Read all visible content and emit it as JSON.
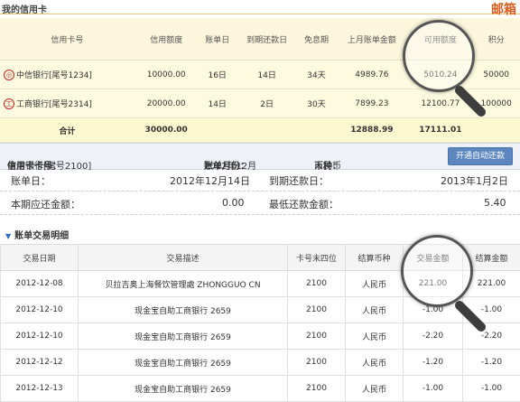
{
  "header": {
    "title": "我的信用卡",
    "mailbox": "邮箱"
  },
  "summary": {
    "columns": [
      "信用卡号",
      "信用额度",
      "账单日",
      "到期还款日",
      "免息期",
      "上月账单金额",
      "可用额度",
      "积分"
    ],
    "rows": [
      {
        "card": "中信银行[尾号1234]",
        "limit": "10000.00",
        "statement_day": "16日",
        "due_day": "14日",
        "free_period": "34天",
        "last_bill": "4989.76",
        "available": "5010.24",
        "points": "50000"
      },
      {
        "card": "工商银行[尾号2314]",
        "limit": "20000.00",
        "statement_day": "14日",
        "due_day": "2日",
        "free_period": "30天",
        "last_bill": "7899.23",
        "available": "12100.77",
        "points": "100000"
      }
    ],
    "total": {
      "label": "合计",
      "limit": "30000.00",
      "last_bill": "12888.99",
      "available": "17111.01"
    }
  },
  "detail": {
    "card_label": "信用卡卡号：",
    "card_value": "中信银行[尾号2100]",
    "month_label": "账单月份：",
    "month_value": "2012年12月",
    "currency_label": "币种：",
    "currency_value": "人民币",
    "auto_repay_button": "开通自动还款",
    "statement_date_label": "账单日：",
    "statement_date_value": "2012年12月14日",
    "due_date_label": "到期还款日：",
    "due_date_value": "2013年1月2日",
    "amount_due_label": "本期应还金额：",
    "amount_due_value": "0.00",
    "min_due_label": "最低还款金额：",
    "min_due_value": "5.40"
  },
  "transactions": {
    "section_title": "账单交易明细",
    "columns": [
      "交易日期",
      "交易描述",
      "卡号末四位",
      "结算币种",
      "交易金额",
      "结算金额"
    ],
    "rows": [
      {
        "date": "2012-12-08",
        "desc": "贝拉吉奥上海餐饮管理處 ZHONGGUO CN",
        "card4": "2100",
        "currency": "人民币",
        "amount": "221.00",
        "settle": "221.00"
      },
      {
        "date": "2012-12-10",
        "desc": "现金宝自助工商银行 2659",
        "card4": "2100",
        "currency": "人民币",
        "amount": "-1.00",
        "settle": "-1.00"
      },
      {
        "date": "2012-12-10",
        "desc": "现金宝自助工商银行 2659",
        "card4": "2100",
        "currency": "人民币",
        "amount": "-2.20",
        "settle": "-2.20"
      },
      {
        "date": "2012-12-12",
        "desc": "现金宝自助工商银行 2659",
        "card4": "2100",
        "currency": "人民币",
        "amount": "-1.20",
        "settle": "-1.20"
      },
      {
        "date": "2012-12-13",
        "desc": "现金宝自助工商银行 2659",
        "card4": "2100",
        "currency": "人民币",
        "amount": "-1.00",
        "settle": "-1.00"
      }
    ]
  }
}
